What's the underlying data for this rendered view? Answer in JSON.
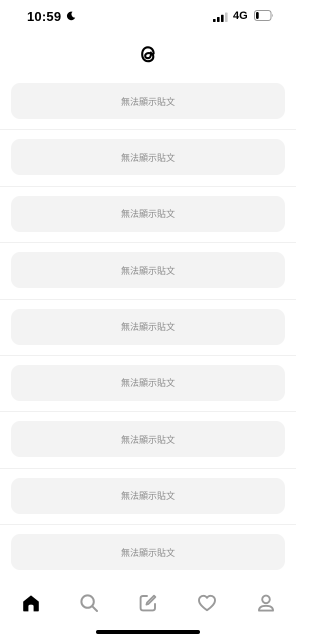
{
  "status_bar": {
    "time": "10:59",
    "network": "4G",
    "battery_level": 0.2
  },
  "header": {
    "logo_icon": "threads-logo-icon"
  },
  "feed": {
    "posts": [
      {
        "text": "無法顯示貼文"
      },
      {
        "text": "無法顯示貼文"
      },
      {
        "text": "無法顯示貼文"
      },
      {
        "text": "無法顯示貼文"
      },
      {
        "text": "無法顯示貼文"
      },
      {
        "text": "無法顯示貼文"
      },
      {
        "text": "無法顯示貼文"
      },
      {
        "text": "無法顯示貼文"
      },
      {
        "text": "無法顯示貼文"
      }
    ]
  },
  "tab_bar": {
    "tabs": [
      {
        "icon": "home-icon",
        "active": true
      },
      {
        "icon": "search-icon",
        "active": false
      },
      {
        "icon": "compose-icon",
        "active": false
      },
      {
        "icon": "heart-icon",
        "active": false
      },
      {
        "icon": "profile-icon",
        "active": false
      }
    ]
  },
  "colors": {
    "card_background": "#f3f3f3",
    "card_text": "#8d8d8d",
    "active_icon": "#000000",
    "inactive_icon": "#9a9a9a"
  }
}
